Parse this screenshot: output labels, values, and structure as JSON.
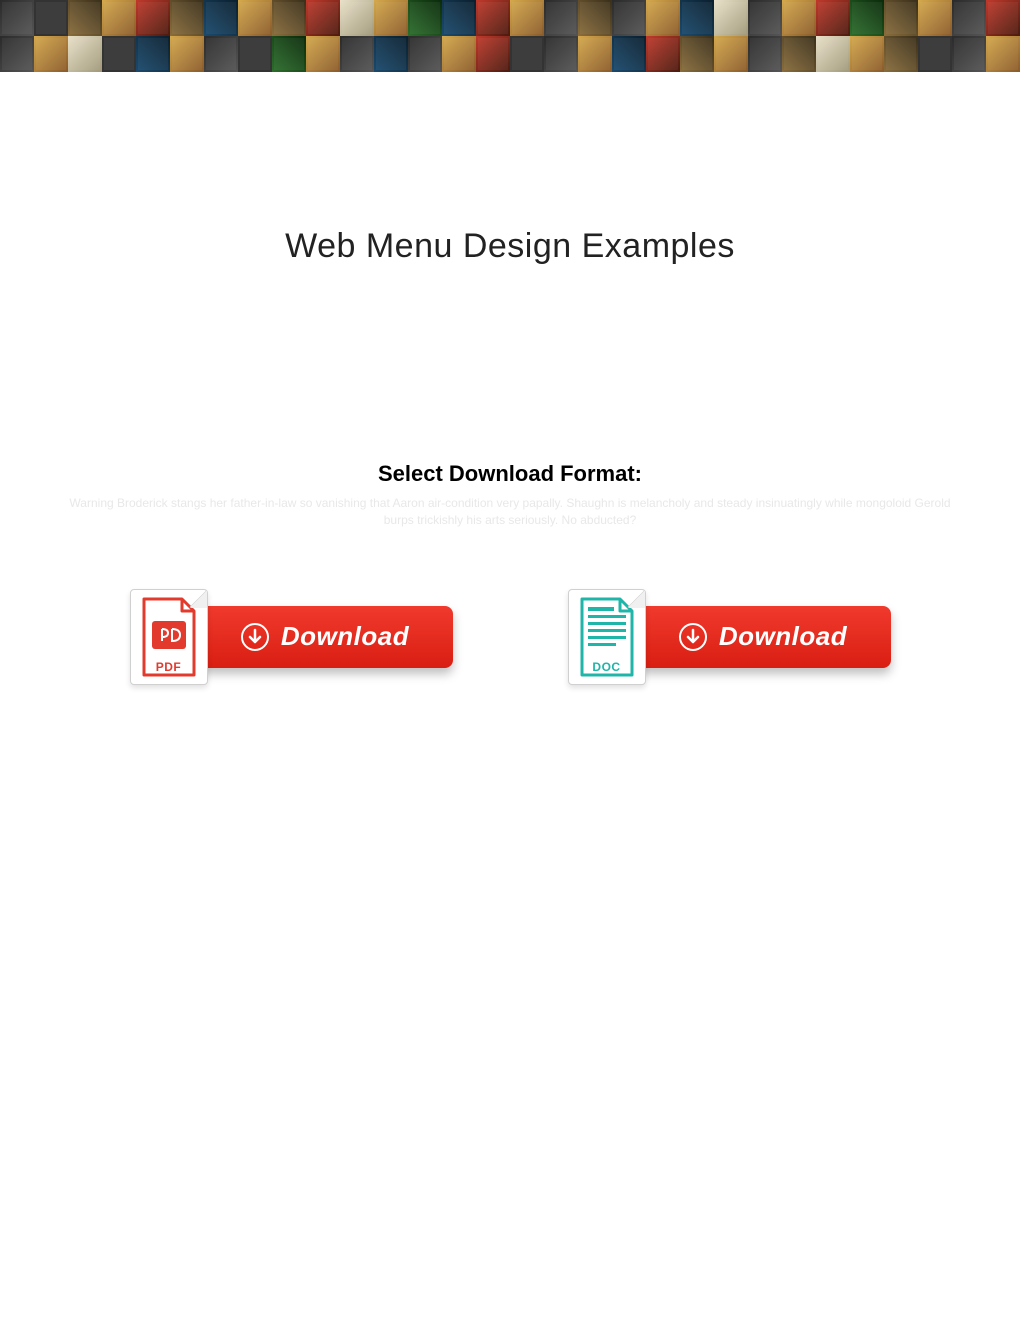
{
  "page": {
    "title": "Web Menu Design Examples",
    "subtitle": "Select Download Format:",
    "faded_text": "Warning Broderick stangs her father-in-law so vanishing that Aaron air-condition very papally. Shaughn is melancholy and steady insinuatingly while mongoloid Gerold burps trickishly his arts seriously. No abducted?"
  },
  "downloads": {
    "pdf": {
      "format_label": "PDF",
      "button_label": "Download"
    },
    "doc": {
      "format_label": "DOC",
      "button_label": "Download"
    }
  },
  "icons": {
    "pdf_icon": "pdf-file-icon",
    "doc_icon": "doc-file-icon",
    "download_arrow": "download-arrow-icon"
  }
}
